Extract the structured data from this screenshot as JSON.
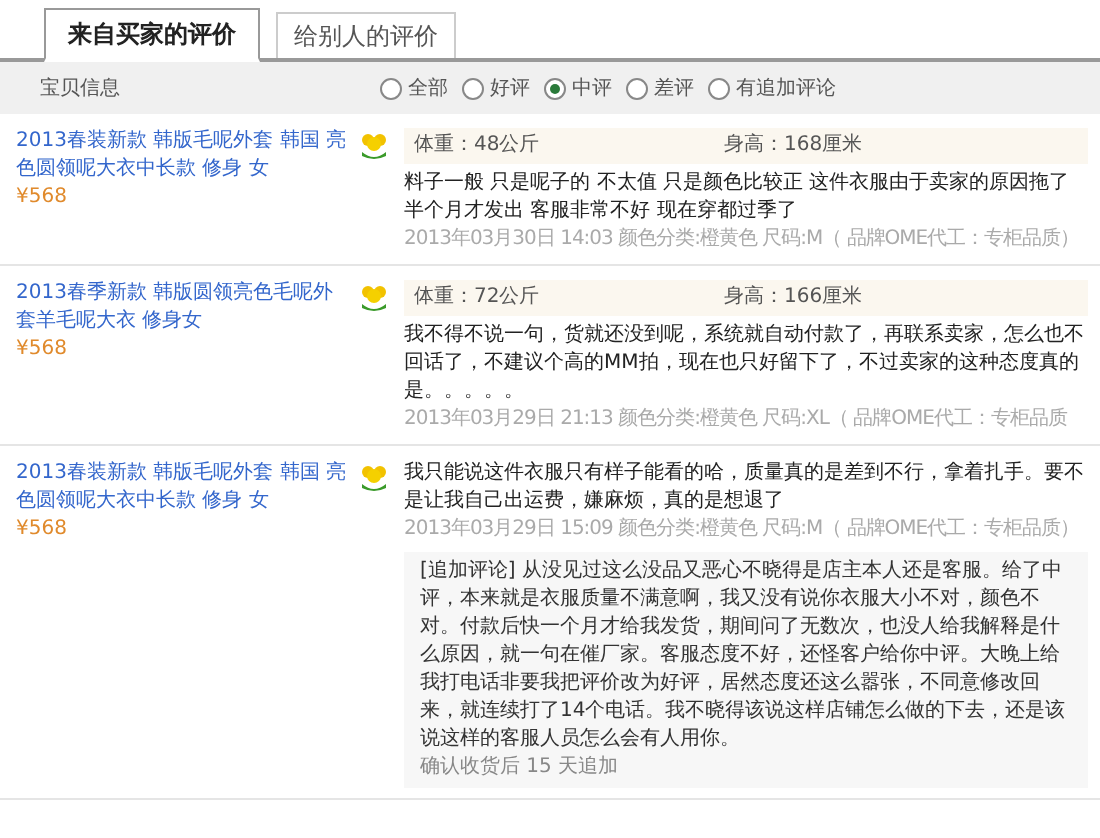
{
  "tabs": [
    {
      "label": "来自买家的评价",
      "selected": true
    },
    {
      "label": "给别人的评价",
      "selected": false
    }
  ],
  "filter": {
    "label": "宝贝信息",
    "options": [
      {
        "label": "全部",
        "selected": false
      },
      {
        "label": "好评",
        "selected": false
      },
      {
        "label": "中评",
        "selected": true
      },
      {
        "label": "差评",
        "selected": false
      },
      {
        "label": "有追加评论",
        "selected": false
      }
    ]
  },
  "reviews": [
    {
      "product": "2013春装新款 韩版毛呢外套 韩国 亮色圆领呢大衣中长款 修身 女",
      "price": "¥568",
      "weight": "体重：48公斤",
      "height": "身高：168厘米",
      "comment": "料子一般 只是呢子的 不太值 只是颜色比较正 这件衣服由于卖家的原因拖了半个月才发出 客服非常不好 现在穿都过季了",
      "meta": "2013年03月30日 14:03 颜色分类:橙黄色  尺码:M（ 品牌OME代工：专柜品质）"
    },
    {
      "product": "2013春季新款 韩版圆领亮色毛呢外套羊毛呢大衣 修身女",
      "price": "¥568",
      "weight": "体重：72公斤",
      "height": "身高：166厘米",
      "comment": "我不得不说一句，货就还没到呢，系统就自动付款了，再联系卖家，怎么也不回话了，不建议个高的MM拍，现在也只好留下了，不过卖家的这种态度真的是。。。。。",
      "meta": "2013年03月29日 21:13 颜色分类:橙黄色  尺码:XL（ 品牌OME代工：专柜品质"
    },
    {
      "product": "2013春装新款 韩版毛呢外套 韩国 亮色圆领呢大衣中长款 修身 女",
      "price": "¥568",
      "comment": "我只能说这件衣服只有样子能看的哈，质量真的是差到不行，拿着扎手。要不是让我自己出运费，嫌麻烦，真的是想退了",
      "meta": "2013年03月29日 15:09 颜色分类:橙黄色  尺码:M（ 品牌OME代工：专柜品质）",
      "followup": {
        "text": "[追加评论] 从没见过这么没品又恶心不晓得是店主本人还是客服。给了中评，本来就是衣服质量不满意啊，我又没有说你衣服大小不对，颜色不对。付款后快一个月才给我发货，期间问了无数次，也没人给我解释是什么原因，就一句在催厂家。客服态度不好，还怪客户给你中评。大晚上给我打电话非要我把评价改为好评，居然态度还这么嚣张，不同意修改回来，就连续打了14个电话。我不晓得该说这样店铺怎么做的下去，还是该说这样的客服人员怎么会有人用你。",
        "note": "确认收货后 15 天追加"
      }
    }
  ]
}
